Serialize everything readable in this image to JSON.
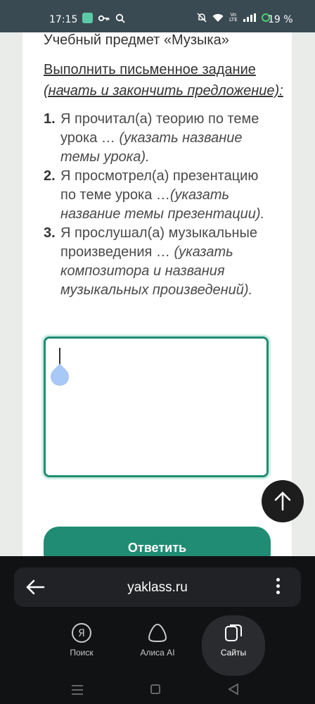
{
  "status_bar": {
    "time": "17:15",
    "battery": "19 %",
    "volte_top": "Vo",
    "volte_bottom": "LTE"
  },
  "content": {
    "subject": "Учебный предмет «Музыка»",
    "task_title": "Выполнить письменное задание",
    "task_hint": "(начать и закончить предложение):",
    "steps": [
      {
        "num": "1.",
        "text": "Я прочитал(а) теорию по теме урока … ",
        "hint": "(указать название темы урока)."
      },
      {
        "num": "2.",
        "text": "Я просмотрел(а) презентацию по теме урока …",
        "hint": "(указать название темы презентации)."
      },
      {
        "num": "3.",
        "text": "Я прослушал(а) музыкальные произведения … ",
        "hint": "(указать композитора и названия музыкальных произведений)."
      }
    ],
    "answer_value": "",
    "submit_label": "Ответить"
  },
  "browser": {
    "url": "yaklass.ru",
    "tabs": [
      {
        "label": "Поиск",
        "icon": "yandex-search-icon"
      },
      {
        "label": "Алиса AI",
        "icon": "alice-icon"
      },
      {
        "label": "Сайты",
        "icon": "sites-icon"
      }
    ],
    "tab_search_glyph": "Я"
  },
  "colors": {
    "accent": "#1f8c73",
    "status_bar": "#3a4a52",
    "panel": "#111214"
  }
}
